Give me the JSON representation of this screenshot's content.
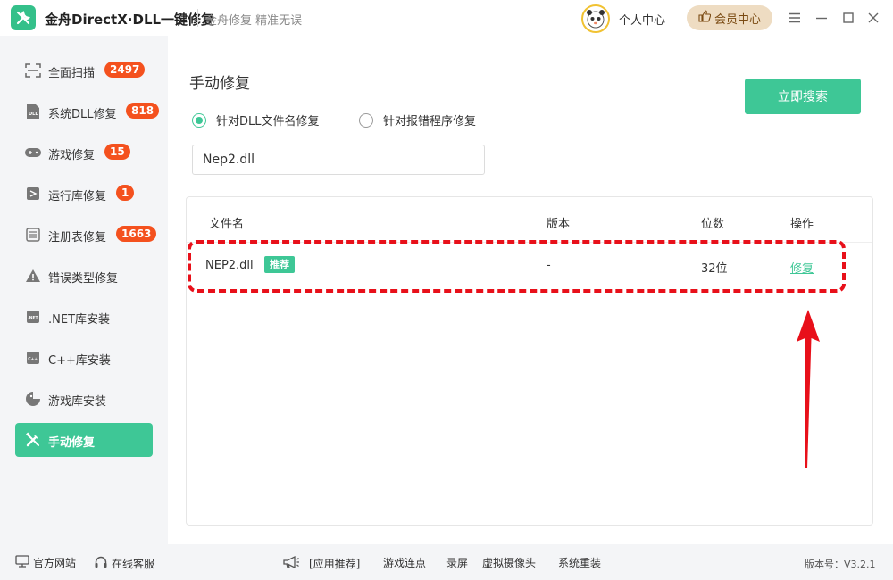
{
  "app": {
    "title": "金舟DirectX·DLL一键修复",
    "slogan": "金舟修复 精准无误"
  },
  "header": {
    "user_center": "个人中心",
    "vip_center": "会员中心"
  },
  "sidebar": {
    "items": [
      {
        "label": "全面扫描",
        "badge": "2497",
        "icon": "scan-icon"
      },
      {
        "label": "系统DLL修复",
        "badge": "818",
        "icon": "dll-icon"
      },
      {
        "label": "游戏修复",
        "badge": "15",
        "icon": "gamepad-icon"
      },
      {
        "label": "运行库修复",
        "badge": "1",
        "icon": "runtime-icon"
      },
      {
        "label": "注册表修复",
        "badge": "1663",
        "icon": "registry-icon"
      },
      {
        "label": "错误类型修复",
        "badge": "",
        "icon": "warning-icon"
      },
      {
        "label": ".NET库安装",
        "badge": "",
        "icon": "dotnet-icon"
      },
      {
        "label": "C++库安装",
        "badge": "",
        "icon": "cpp-icon"
      },
      {
        "label": "游戏库安装",
        "badge": "",
        "icon": "game-lib-icon"
      },
      {
        "label": "手动修复",
        "badge": "",
        "icon": "tools-icon",
        "active": true
      }
    ]
  },
  "main": {
    "title": "手动修复",
    "search_button": "立即搜索",
    "radio_dll": "针对DLL文件名修复",
    "radio_program": "针对报错程序修复",
    "input_value": "Nep2.dll",
    "table": {
      "headers": [
        "文件名",
        "版本",
        "位数",
        "操作"
      ],
      "rows": [
        {
          "name": "NEP2.dll",
          "tag": "推荐",
          "version": "-",
          "bits": "32位",
          "action": "修复"
        }
      ]
    }
  },
  "footer": {
    "website": "官方网站",
    "support": "在线客服",
    "recommend": "[应用推荐]",
    "links": [
      "游戏连点",
      "录屏",
      "虚拟摄像头",
      "系统重装"
    ],
    "version": "版本号：V3.2.1"
  },
  "colors": {
    "accent": "#3ec796",
    "badge": "#f4511e",
    "highlight": "#e8101a",
    "vip_bg": "#eedcc2"
  }
}
